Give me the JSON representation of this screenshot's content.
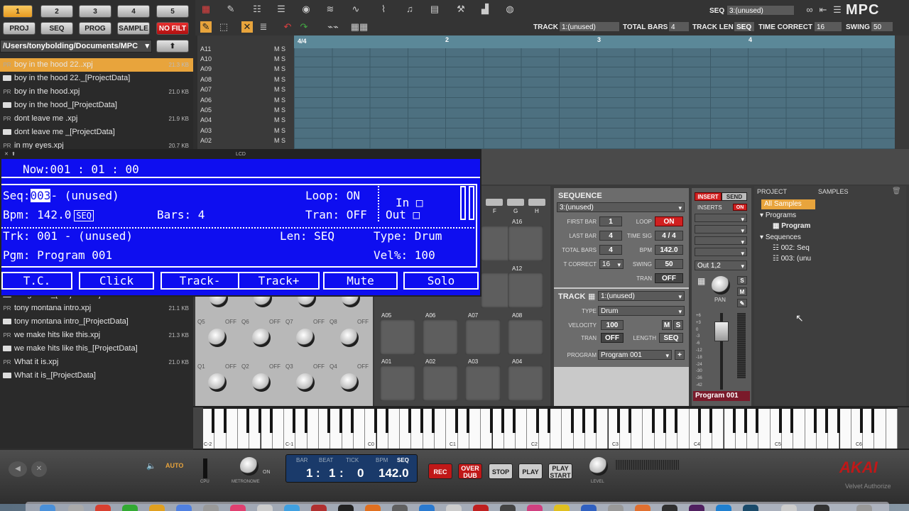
{
  "top": {
    "banks": [
      "1",
      "2",
      "3",
      "4",
      "5"
    ],
    "modes": [
      "PROJ",
      "SEQ",
      "PROG",
      "SAMPLE",
      "NO FILT"
    ],
    "path": "/Users/tonybolding/Documents/MPC"
  },
  "browser": {
    "files": [
      {
        "pre": "PR",
        "name": "boy in the hood 22..xpj",
        "size": "21.3 KB",
        "sel": true
      },
      {
        "pre": "",
        "name": "boy in the hood 22._[ProjectData]",
        "size": "",
        "folder": true
      },
      {
        "pre": "PR",
        "name": "boy in the hood.xpj",
        "size": "21.0 KB"
      },
      {
        "pre": "",
        "name": "boy in the hood_[ProjectData]",
        "size": "",
        "folder": true
      },
      {
        "pre": "PR",
        "name": "dont leave  me .xpj",
        "size": "21.9 KB"
      },
      {
        "pre": "",
        "name": "dont leave  me _[ProjectData]",
        "size": "",
        "folder": true
      },
      {
        "pre": "PR",
        "name": "in my eyes.xpj",
        "size": "20.7 KB"
      }
    ],
    "files2": [
      {
        "pre": "",
        "name": "the groove_[ProjectData]",
        "size": "",
        "folder": true
      },
      {
        "pre": "PR",
        "name": "tony montana intro.xpj",
        "size": "21.1 KB"
      },
      {
        "pre": "",
        "name": "tony montana intro_[ProjectData]",
        "size": "",
        "folder": true
      },
      {
        "pre": "PR",
        "name": "we make hits like this.xpj",
        "size": "21.3 KB"
      },
      {
        "pre": "",
        "name": "we make hits like this_[ProjectData]",
        "size": "",
        "folder": true
      },
      {
        "pre": "PR",
        "name": "What it is.xpj",
        "size": "21.0 KB"
      },
      {
        "pre": "",
        "name": "What it is_[ProjectData]",
        "size": "",
        "folder": true
      }
    ]
  },
  "header": {
    "seq_label": "SEQ",
    "seq_value": "3:(unused)",
    "brand": "MPC",
    "track_label": "TRACK",
    "track_value": "1:(unused)",
    "total_bars_label": "TOTAL BARS",
    "total_bars": "4",
    "track_len_label": "TRACK LEN",
    "track_len": "SEQ",
    "time_correct_label": "TIME CORRECT",
    "time_correct": "16",
    "swing_label": "SWING",
    "swing": "50"
  },
  "grid": {
    "timesig": "4/4",
    "bars": [
      "2",
      "3",
      "4"
    ],
    "tracks": [
      "A11",
      "A10",
      "A09",
      "A08",
      "A07",
      "A06",
      "A05",
      "A04",
      "A03",
      "A02"
    ],
    "ms": "M S"
  },
  "lcd": {
    "title": "LCD",
    "now": "Now:001 : 01  : 00",
    "seq_prefix": "Seq:",
    "seq_num": "003",
    "seq_name": "- (unused)",
    "loop": "Loop: ON",
    "bpm_prefix": "Bpm: 142.0",
    "bpm_src": "SEQ",
    "bars": "Bars: 4",
    "tran": "Tran: OFF",
    "in": "In",
    "out": "Out",
    "trk": "Trk: 001 - (unused)",
    "len": "Len: SEQ",
    "type": "Type: Drum",
    "pgm": "Pgm: Program 001",
    "vel": "Vel%: 100",
    "buttons": [
      "T.C.",
      "Click",
      "Track-",
      "Track+",
      "Mute",
      "Solo"
    ]
  },
  "qlink": {
    "off": "OFF",
    "row1": [
      "Q5",
      "Q6",
      "Q7",
      "Q8"
    ],
    "row2": [
      "Q1",
      "Q2",
      "Q3",
      "Q4"
    ]
  },
  "pads": {
    "letters": [
      "F",
      "G",
      "H"
    ],
    "labels": [
      "A16",
      "A12",
      "A05",
      "A06",
      "A07",
      "A08",
      "A01",
      "A02",
      "A03",
      "A04"
    ]
  },
  "sequence": {
    "title": "SEQUENCE",
    "name": "3:(unused)",
    "first_bar_l": "FIRST BAR",
    "first_bar": "1",
    "loop_l": "LOOP",
    "loop": "ON",
    "last_bar_l": "LAST BAR",
    "last_bar": "4",
    "timesig_l": "TIME SIG",
    "timesig": "4 / 4",
    "total_bars_l": "TOTAL BARS",
    "total_bars": "4",
    "bpm_l": "BPM",
    "bpm": "142.0",
    "tcorrect_l": "T CORRECT",
    "tcorrect": "16",
    "swing_l": "SWING",
    "swing": "50",
    "tran_l": "TRAN",
    "tran": "OFF"
  },
  "track": {
    "title": "TRACK",
    "name": "1:(unused)",
    "type_l": "TYPE",
    "type": "Drum",
    "velocity_l": "VELOCITY",
    "velocity": "100",
    "m": "M",
    "s": "S",
    "tran_l": "TRAN",
    "tran": "OFF",
    "length_l": "LENGTH",
    "length": "SEQ",
    "program_l": "PROGRAM",
    "program": "Program 001",
    "plus": "+"
  },
  "mixer": {
    "insert": "INSERT",
    "send": "SEND",
    "inserts": "INSERTS",
    "on": "ON",
    "out": "Out 1,2",
    "pan": "PAN",
    "s": "S",
    "m": "M",
    "program": "Program 001",
    "scale": [
      "+6",
      "+3",
      "0",
      "-3",
      "-6",
      "-12",
      "-18",
      "-24",
      "-30",
      "-36",
      "-42"
    ]
  },
  "project": {
    "tab1": "PROJECT",
    "tab2": "SAMPLES",
    "all": "All Samples",
    "programs": "Programs",
    "program": "Program",
    "sequences": "Sequences",
    "seq2": "002: Seq",
    "seq3": "003: (unu"
  },
  "keyboard": {
    "octaves": [
      "C-2",
      "C-1",
      "C0",
      "C1",
      "C2",
      "C3",
      "C4",
      "C5",
      "C6"
    ]
  },
  "transport": {
    "auto": "AUTO",
    "cpu": "CPU",
    "metronome": "METRONOME",
    "on": "ON",
    "bar_l": "BAR",
    "beat_l": "BEAT",
    "tick_l": "TICK",
    "bpm_l": "BPM",
    "seq_l": "SEQ",
    "bar": "1",
    "beat": "1",
    "tick": "0",
    "bpm": "142.0",
    "rec": "REC",
    "overdub": "OVER DUB",
    "stop": "STOP",
    "play": "PLAY",
    "playstart": "PLAY START",
    "level": "LEVEL",
    "brand": "AKAI",
    "sub": "Velvet Authorize"
  },
  "colors": {
    "lcd": "#0e0ef0",
    "accent": "#e8a43c",
    "record": "#d02020"
  }
}
